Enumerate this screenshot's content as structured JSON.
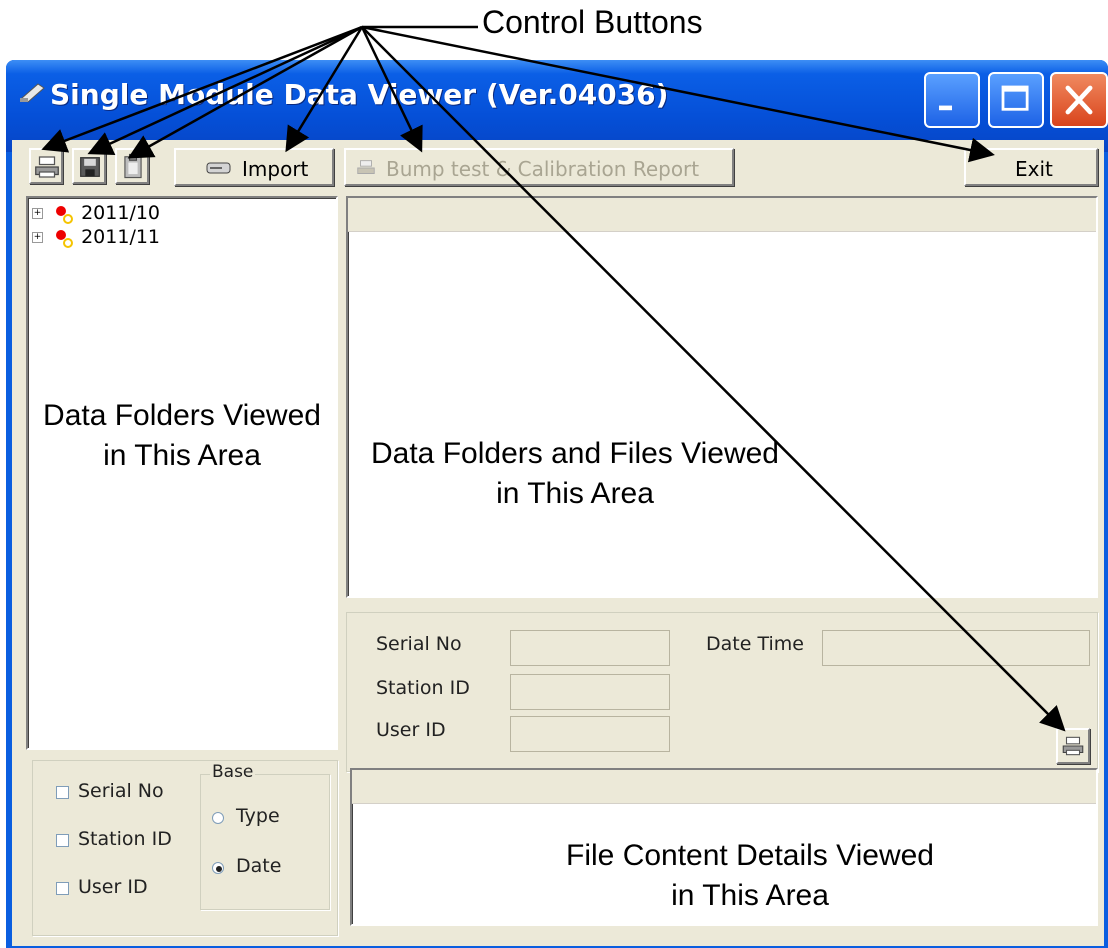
{
  "annotation": {
    "label": "Control Buttons"
  },
  "window": {
    "title": "Single Module Data Viewer (Ver.04036)"
  },
  "toolbar": {
    "import_label": "Import",
    "report_label": "Bump test & Calibration Report",
    "exit_label": "Exit"
  },
  "tree": {
    "items": [
      "2011/10",
      "2011/11"
    ]
  },
  "areas": {
    "folders": "Data Folders Viewed in This Area",
    "files": "Data Folders and Files Viewed in This Area",
    "details": "File Content Details Viewed in This Area"
  },
  "filters": {
    "serial_no": "Serial No",
    "station_id": "Station ID",
    "user_id": "User ID",
    "base_title": "Base",
    "type_label": "Type",
    "date_label": "Date",
    "selected_base": "Date"
  },
  "info": {
    "serial_no_label": "Serial No",
    "station_id_label": "Station ID",
    "user_id_label": "User ID",
    "date_time_label": "Date Time"
  },
  "colors": {
    "titlebar": "#0550d8",
    "face": "#ece9d8",
    "close": "#d9441c"
  }
}
